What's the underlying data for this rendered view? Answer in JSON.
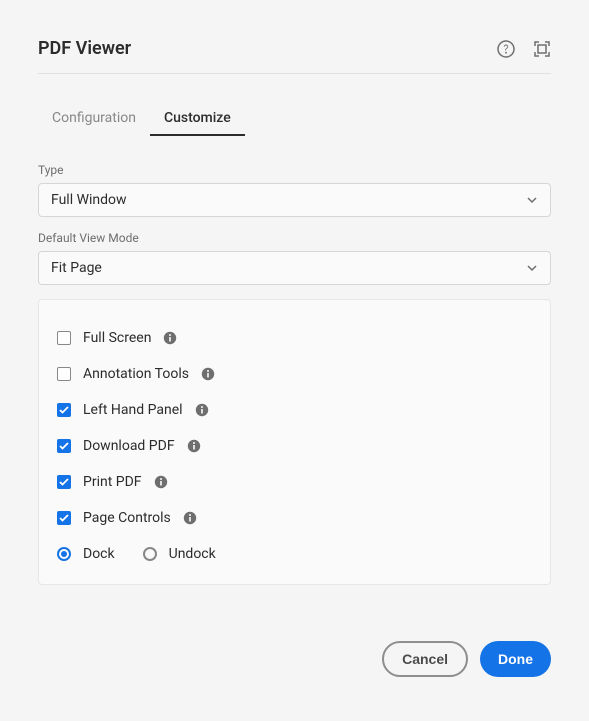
{
  "header": {
    "title": "PDF Viewer"
  },
  "tabs": {
    "configuration": "Configuration",
    "customize": "Customize"
  },
  "fields": {
    "type_label": "Type",
    "type_value": "Full Window",
    "viewmode_label": "Default View Mode",
    "viewmode_value": "Fit Page"
  },
  "options": {
    "full_screen": "Full Screen",
    "annotation_tools": "Annotation Tools",
    "left_hand_panel": "Left Hand Panel",
    "download_pdf": "Download PDF",
    "print_pdf": "Print PDF",
    "page_controls": "Page Controls"
  },
  "radios": {
    "dock": "Dock",
    "undock": "Undock"
  },
  "footer": {
    "cancel": "Cancel",
    "done": "Done"
  }
}
